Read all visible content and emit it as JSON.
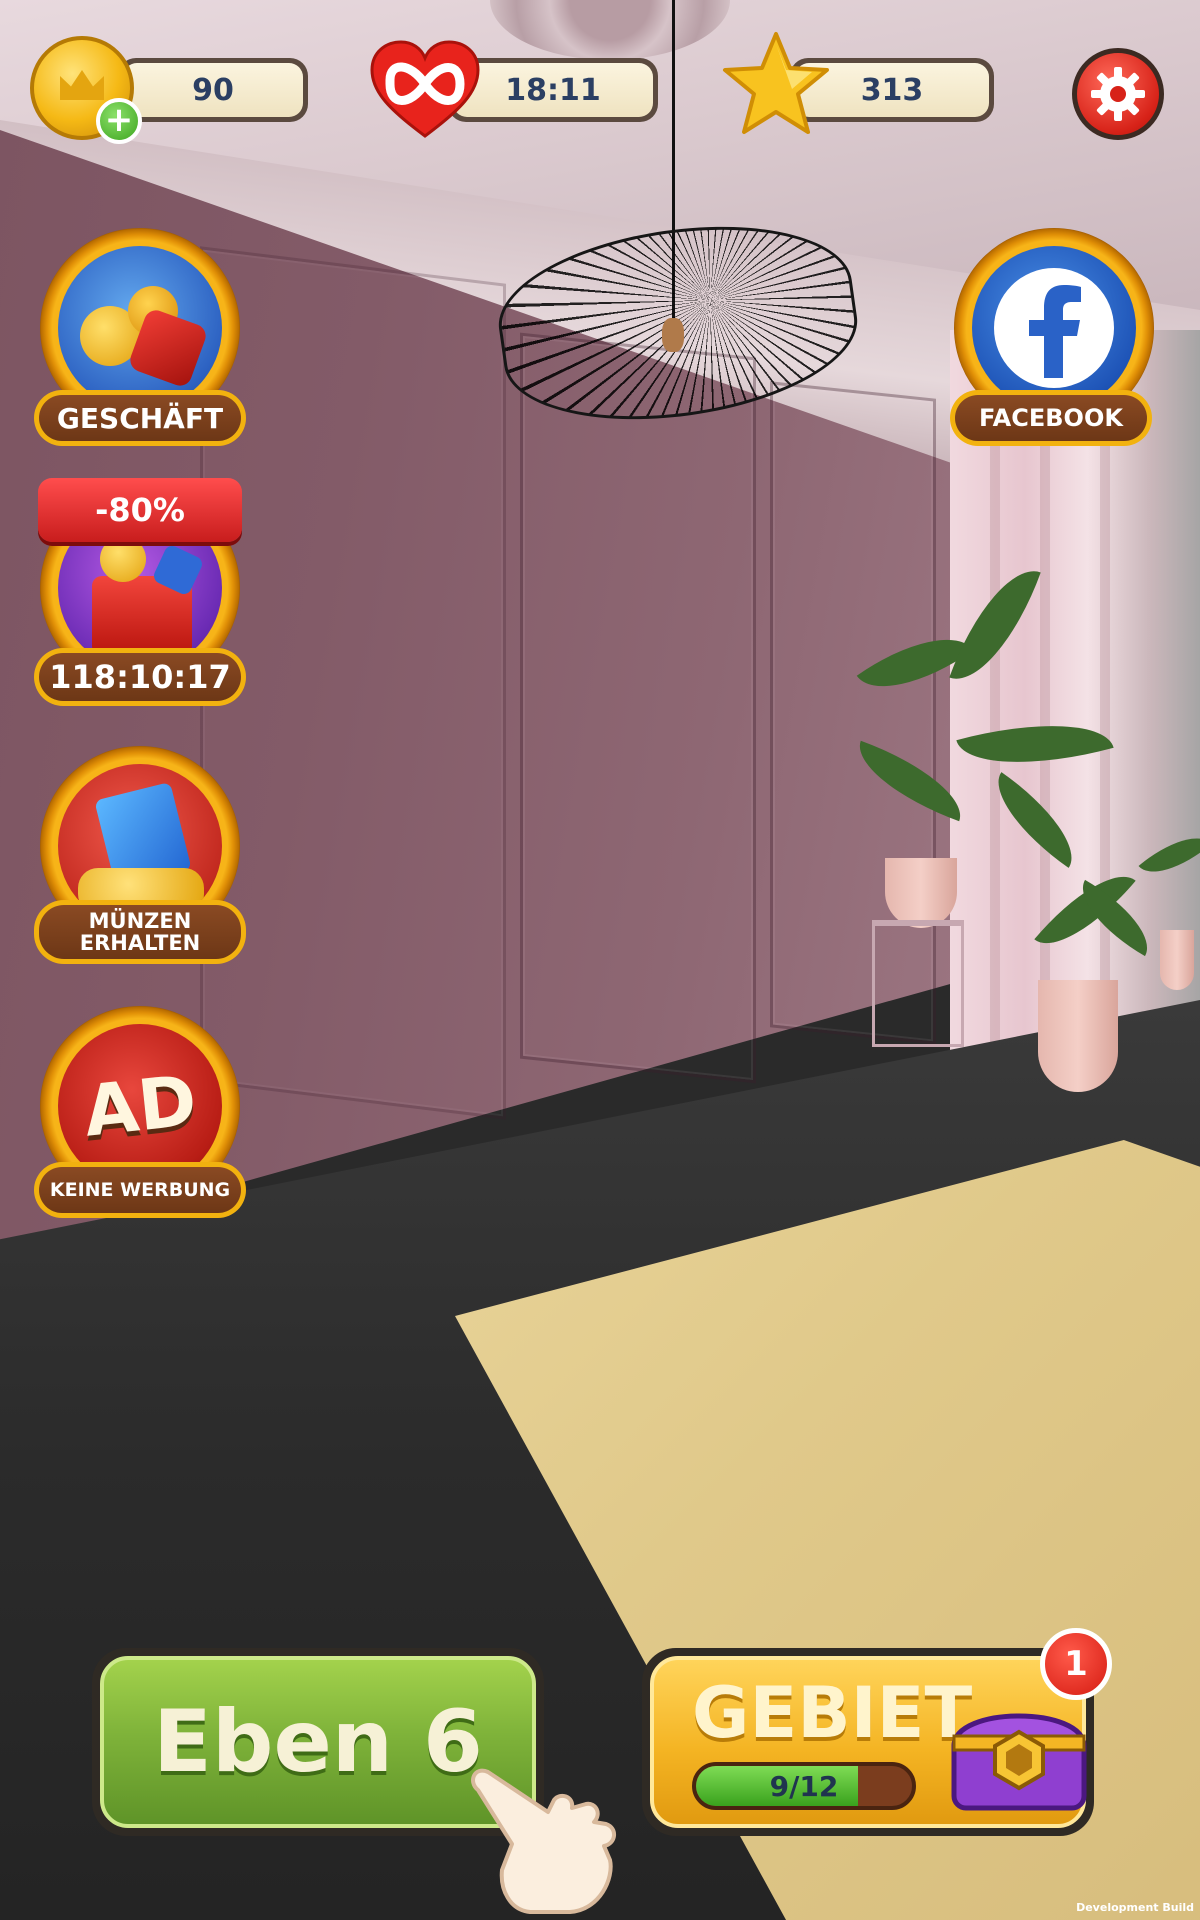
{
  "hud": {
    "coins": "90",
    "lives": "18:11",
    "stars": "313"
  },
  "side_left": {
    "shop_label": "GESCHÄFT",
    "offer_discount": "-80%",
    "offer_timer": "118:10:17",
    "coins_label_1": "MÜNZEN",
    "coins_label_2": "ERHALTEN",
    "ad_icon_text": "AD",
    "no_ads_label": "KEINE WERBUNG"
  },
  "side_right": {
    "facebook_label": "FACEBOOK"
  },
  "bottom": {
    "level_label": "Eben 6",
    "area_label": "GEBIET",
    "area_progress_text": "9/12",
    "area_progress_fraction": 0.75,
    "notification_count": "1"
  },
  "footer": {
    "build_text": "Development Build"
  },
  "colors": {
    "level_green": "#7fb33a",
    "area_gold": "#f4b423",
    "badge_red": "#d51b12",
    "hud_text": "#2b3f63"
  },
  "icons": [
    "coin-icon",
    "plus-icon",
    "heart-infinity-icon",
    "star-icon",
    "gear-icon",
    "shop-icon",
    "offer-gift-icon",
    "movie-coins-icon",
    "ad-icon",
    "facebook-icon",
    "chest-icon",
    "pointing-hand-icon"
  ]
}
